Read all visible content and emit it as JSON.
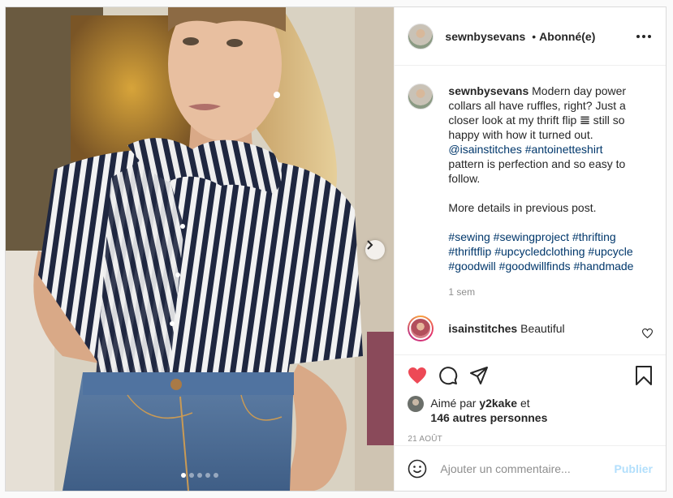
{
  "post": {
    "username": "sewnbysevans",
    "separator": "•",
    "follow_status": "Abonné(e)",
    "more_icon": "more-horizontal-icon"
  },
  "caption": {
    "username": "sewnbysevans",
    "text_1": "Modern day power collars all have ruffles, right? Just a closer look at my thrift flip 𝌆 still so happy with how it turned out.",
    "mention": "@isainstitches",
    "hashtag_pattern": "#antoinetteshirt",
    "text_2": "pattern is perfection and so easy to follow.",
    "text_3": "More details in previous post.",
    "hashtags": [
      "#sewing",
      "#sewingproject",
      "#thrifting",
      "#thriftflip",
      "#upcycledclothing",
      "#upcycle",
      "#goodwill",
      "#goodwillfinds",
      "#handmade"
    ],
    "time": "1 sem"
  },
  "comment": {
    "username": "isainstitches",
    "text": "Beautiful"
  },
  "likes": {
    "prefix": "Aimé par",
    "user": "y2kake",
    "conjunction": "et",
    "others": "146 autres personnes",
    "liked": true
  },
  "date": "21 AOÛT",
  "add_comment": {
    "placeholder": "Ajouter un commentaire...",
    "publish_label": "Publier"
  },
  "carousel": {
    "count": 5,
    "active_index": 0
  },
  "colors": {
    "like_red": "#ed4956",
    "link_blue": "#00376b",
    "publish_disabled": "#b2dffc",
    "muted": "#8e8e8e"
  }
}
